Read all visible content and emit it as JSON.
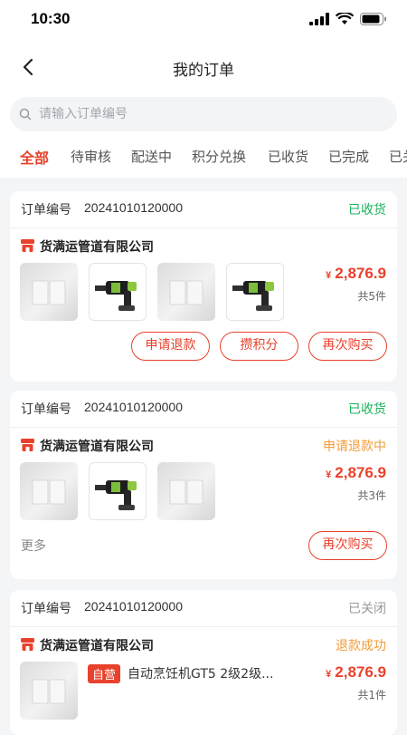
{
  "status_bar": {
    "time": "10:30"
  },
  "header": {
    "title": "我的订单"
  },
  "search": {
    "placeholder": "请输入订单编号"
  },
  "tabs": [
    {
      "label": "全部",
      "active": true
    },
    {
      "label": "待审核"
    },
    {
      "label": "配送中"
    },
    {
      "label": "积分兑换"
    },
    {
      "label": "已收货"
    },
    {
      "label": "已完成"
    },
    {
      "label": "已关"
    }
  ],
  "order_label": "订单编号",
  "orders": [
    {
      "order_no": "20241010120000",
      "status": "已收货",
      "shop": "货满运管道有限公司",
      "thumbs": [
        "switch",
        "drill",
        "switch",
        "drill"
      ],
      "currency": "¥",
      "price": "2,876.9",
      "qty": "共5件",
      "buttons": [
        "申请退款",
        "攒积分",
        "再次购买"
      ]
    },
    {
      "order_no": "20241010120000",
      "status": "已收货",
      "shop": "货满运管道有限公司",
      "after_sale": "申请退款中",
      "thumbs": [
        "switch",
        "drill",
        "switch"
      ],
      "currency": "¥",
      "price": "2,876.9",
      "qty": "共3件",
      "more": "更多",
      "buttons": [
        "再次购买"
      ]
    },
    {
      "order_no": "20241010120000",
      "status": "已关闭",
      "shop": "货满运管道有限公司",
      "after_sale": "退款成功",
      "thumbs": [
        "switch"
      ],
      "tag": "自营",
      "product_name": "自动烹饪机GT5 2级2级...",
      "currency": "¥",
      "price": "2,876.9",
      "qty": "共1件"
    }
  ],
  "colors": {
    "accent": "#e8412c",
    "green": "#1ab15b",
    "orange": "#f29b3a"
  }
}
